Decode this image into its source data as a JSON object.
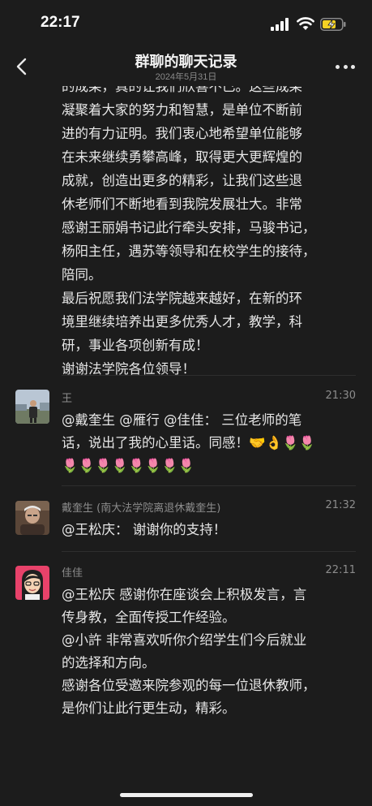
{
  "status": {
    "time": "22:17"
  },
  "nav": {
    "title": "群聊的聊天记录",
    "subtitle": "2024年5月31日"
  },
  "continuation_lines": [
    "的成果，真的让我们欣喜不已。这些成果",
    "凝聚着大家的努力和智慧，是单位不断前",
    "进的有力证明。我们衷心地希望单位能够",
    "在未来继续勇攀高峰，取得更大更辉煌的",
    "成就，创造出更多的精彩，让我们这些退",
    "休老师们不断地看到我院发展壮大。非常",
    "感谢王丽娟书记此行牵头安排，马骏书记，",
    "杨阳主任，遇苏等领导和在校学生的接待，",
    "陪同。",
    "最后祝愿我们法学院越来越好，在新的环",
    "境里继续培养出更多优秀人才，教学，科",
    "研，事业各项创新有成！",
    " 谢谢法学院各位领导！"
  ],
  "messages": [
    {
      "sender": "王",
      "time": "21:30",
      "lines": [
        "@戴奎生 @雁行 @佳佳： 三位老师的笔",
        "话，说出了我的心里话。同感！🤝👌🌷🌷",
        "🌷🌷🌷🌷🌷🌷🌷🌷"
      ]
    },
    {
      "sender": "戴奎生 (南大法学院离退休戴奎生)",
      "time": "21:32",
      "lines": [
        "@王松庆： 谢谢你的支持！"
      ]
    },
    {
      "sender": "佳佳",
      "time": "22:11",
      "lines": [
        "@王松庆 感谢你在座谈会上积极发言，言",
        "传身教，全面传授工作经验。",
        "@小許 非常喜欢听你介绍学生们今后就业",
        "的选择和方向。",
        "感谢各位受邀来院参观的每一位退休教师，",
        "是你们让此行更生动，精彩。"
      ]
    }
  ]
}
